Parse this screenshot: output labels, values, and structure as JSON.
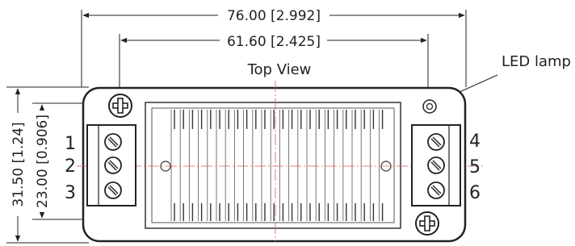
{
  "drawing": {
    "overall_width_dim": "76.00 [2.992]",
    "hole_spacing_dim": "61.60 [2.425]",
    "view_label": "Top View",
    "led_label": "LED lamp",
    "overall_height_dim": "31.50 [1.24]",
    "terminal_height_dim": "23.00 [0.906]",
    "pins_left": [
      "1",
      "2",
      "3"
    ],
    "pins_right": [
      "4",
      "5",
      "6"
    ]
  },
  "colors": {
    "line": "#222222",
    "center_line": "#e05a5a",
    "body_fill": "#ffffff"
  }
}
